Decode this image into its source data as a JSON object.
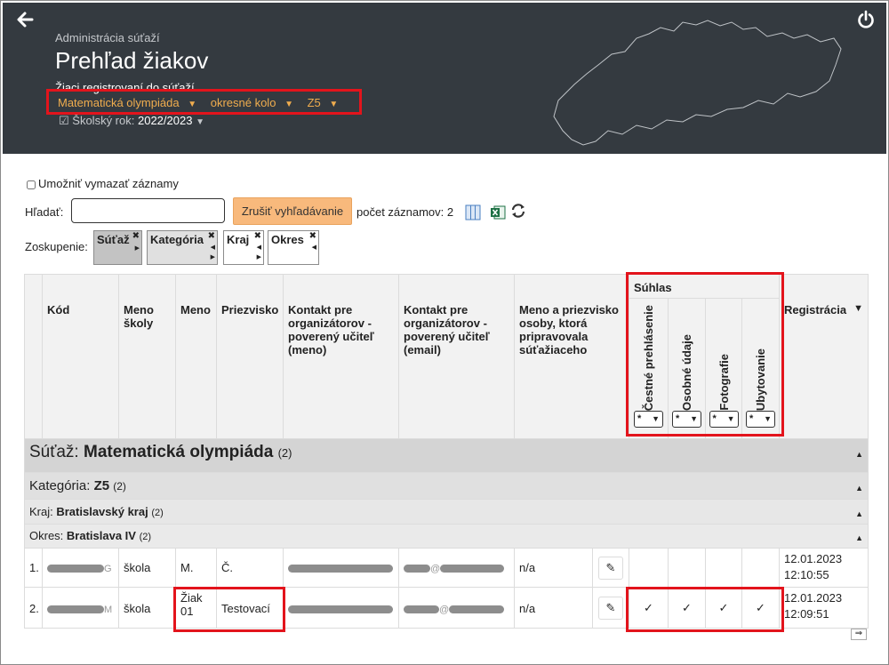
{
  "header": {
    "breadcrumb": "Administrácia súťaží",
    "title": "Prehľad žiakov",
    "subtitle": "Žiaci registrovaní do súťaží",
    "filters": [
      "Matematická olympiáda",
      "okresné kolo",
      "Z5"
    ],
    "school_year_label": "Školský rok:",
    "school_year_value": "2022/2023"
  },
  "toolbar": {
    "allow_delete_label": "Umožniť vymazať záznamy",
    "search_label": "Hľadať:",
    "search_value": "",
    "cancel_search_label": "Zrušiť vyhľadávanie",
    "record_count": "počet záznamov: 2"
  },
  "grouping": {
    "label": "Zoskupenie:",
    "chips": [
      "Súťaž",
      "Kategória",
      "Kraj",
      "Okres"
    ]
  },
  "table": {
    "columns": {
      "code": "Kód",
      "school": "Meno školy",
      "first_name": "Meno",
      "last_name": "Priezvisko",
      "contact_name": "Kontakt pre organizátorov - poverený učiteľ (meno)",
      "contact_email": "Kontakt pre organizátorov - poverený učiteľ (email)",
      "preparer": "Meno a priezvisko osoby, ktorá pripravovala súťažiaceho",
      "consent": "Súhlas",
      "consent_sub": [
        "Čestné prehlásenie",
        "Osobné údaje",
        "Fotografie",
        "Ubytovanie"
      ],
      "registration": "Registrácia"
    },
    "consent_filter_value": "*",
    "groups": {
      "competition_label": "Súťaž:",
      "competition": "Matematická olympiáda",
      "competition_count": "(2)",
      "category_label": "Kategória:",
      "category": "Z5",
      "category_count": "(2)",
      "region_label": "Kraj:",
      "region": "Bratislavský kraj",
      "region_count": "(2)",
      "district_label": "Okres:",
      "district": "Bratislava IV",
      "district_count": "(2)"
    },
    "rows": [
      {
        "num": "1.",
        "code_visible": "G",
        "school": "škola",
        "first_name": "M.",
        "last_name": "Č.",
        "email_visible": "@",
        "preparer": "n/a",
        "consents": [
          "",
          "",
          "",
          ""
        ],
        "reg_date": "12.01.2023",
        "reg_time": "12:10:55"
      },
      {
        "num": "2.",
        "code_visible": "M",
        "school": "škola",
        "first_name": "Žiak 01",
        "last_name": "Testovací",
        "email_visible": "@",
        "preparer": "n/a",
        "consents": [
          "✓",
          "✓",
          "✓",
          "✓"
        ],
        "reg_date": "12.01.2023",
        "reg_time": "12:09:51"
      }
    ]
  },
  "colors": {
    "header_bg": "#343a40",
    "accent_orange": "#f0ad4e",
    "annotation_red": "#e3141c",
    "button_orange": "#f8b97c"
  }
}
